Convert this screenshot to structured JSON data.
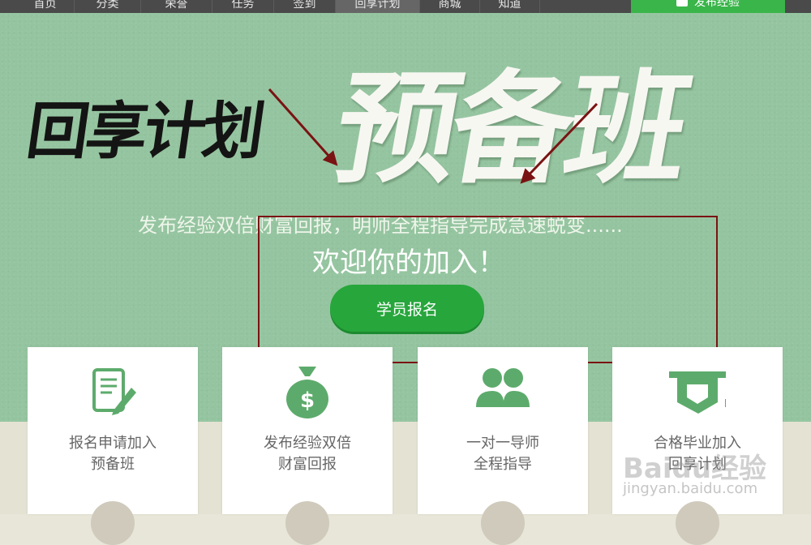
{
  "nav": {
    "items": [
      {
        "label": "首页",
        "active": false
      },
      {
        "label": "分类",
        "active": false
      },
      {
        "label": "荣誉",
        "active": false
      },
      {
        "label": "任务",
        "active": false
      },
      {
        "label": "签到",
        "active": false
      },
      {
        "label": "回享计划",
        "active": true
      },
      {
        "label": "商城",
        "active": false
      },
      {
        "label": "知道",
        "active": false
      }
    ],
    "publish_label": "发布经验"
  },
  "hero": {
    "calligraphy_left": "回享计划",
    "calligraphy_right": "预备班",
    "subtitle": "发布经验双倍财富回报，明师全程指导完成急速蜕变......",
    "welcome": "欢迎你的加入！",
    "signup_label": "学员报名"
  },
  "cards": [
    {
      "icon": "application-form-icon",
      "line1": "报名申请加入",
      "line2": "预备班"
    },
    {
      "icon": "money-bag-icon",
      "line1": "发布经验双倍",
      "line2": "财富回报"
    },
    {
      "icon": "mentor-users-icon",
      "line1": "一对一导师",
      "line2": "全程指导"
    },
    {
      "icon": "graduation-cap-icon",
      "line1": "合格毕业加入",
      "line2": "回享计划"
    }
  ],
  "watermark": {
    "brand": "Baidu经验",
    "url": "jingyan.baidu.com"
  },
  "colors": {
    "accent": "#27a63c",
    "nav_bg": "#4a4a4a",
    "hero_bg": "#95c5a0",
    "annotation": "#7a1313"
  }
}
